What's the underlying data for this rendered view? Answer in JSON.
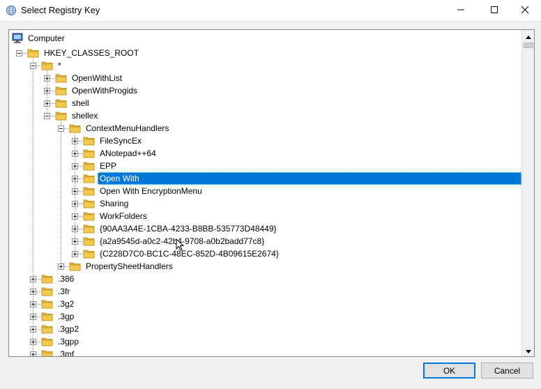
{
  "window": {
    "title": "Select Registry Key",
    "icons": {
      "app": "registry-globe-icon",
      "minimize": "minimize-icon",
      "maximize": "maximize-icon",
      "close": "close-icon"
    }
  },
  "tree": {
    "root_label": "Computer",
    "nodes": [
      {
        "label": "HKEY_CLASSES_ROOT",
        "level": 0,
        "expander": "minus"
      },
      {
        "label": "*",
        "level": 1,
        "expander": "minus"
      },
      {
        "label": "OpenWithList",
        "level": 2,
        "expander": "plus"
      },
      {
        "label": "OpenWithProgids",
        "level": 2,
        "expander": "plus"
      },
      {
        "label": "shell",
        "level": 2,
        "expander": "plus"
      },
      {
        "label": "shellex",
        "level": 2,
        "expander": "minus"
      },
      {
        "label": "ContextMenuHandlers",
        "level": 3,
        "expander": "minus"
      },
      {
        "label": " FileSyncEx",
        "level": 4,
        "expander": "plus"
      },
      {
        "label": "ANotepad++64",
        "level": 4,
        "expander": "plus"
      },
      {
        "label": "EPP",
        "level": 4,
        "expander": "plus"
      },
      {
        "label": "Open With",
        "level": 4,
        "expander": "plus",
        "selected": true
      },
      {
        "label": "Open With EncryptionMenu",
        "level": 4,
        "expander": "plus"
      },
      {
        "label": "Sharing",
        "level": 4,
        "expander": "plus"
      },
      {
        "label": "WorkFolders",
        "level": 4,
        "expander": "plus"
      },
      {
        "label": "{90AA3A4E-1CBA-4233-B8BB-535773D48449}",
        "level": 4,
        "expander": "plus"
      },
      {
        "label": "{a2a9545d-a0c2-42b4-9708-a0b2badd77c8}",
        "level": 4,
        "expander": "plus"
      },
      {
        "label": "{C228D7C0-BC1C-48EC-852D-4B09615E2674}",
        "level": 4,
        "expander": "plus"
      },
      {
        "label": "PropertySheetHandlers",
        "level": 3,
        "expander": "plus"
      },
      {
        "label": ".386",
        "level": 1,
        "expander": "plus"
      },
      {
        "label": ".3fr",
        "level": 1,
        "expander": "plus"
      },
      {
        "label": ".3g2",
        "level": 1,
        "expander": "plus"
      },
      {
        "label": ".3gp",
        "level": 1,
        "expander": "plus"
      },
      {
        "label": ".3gp2",
        "level": 1,
        "expander": "plus"
      },
      {
        "label": ".3gpp",
        "level": 1,
        "expander": "plus"
      },
      {
        "label": ".3mf",
        "level": 1,
        "expander": "plus"
      }
    ],
    "icons": {
      "root": "computer-icon",
      "node": "folder-icon"
    }
  },
  "buttons": {
    "ok_label": "OK",
    "cancel_label": "Cancel"
  },
  "colors": {
    "selection": "#0078d7",
    "folder": "#f2c94c"
  }
}
